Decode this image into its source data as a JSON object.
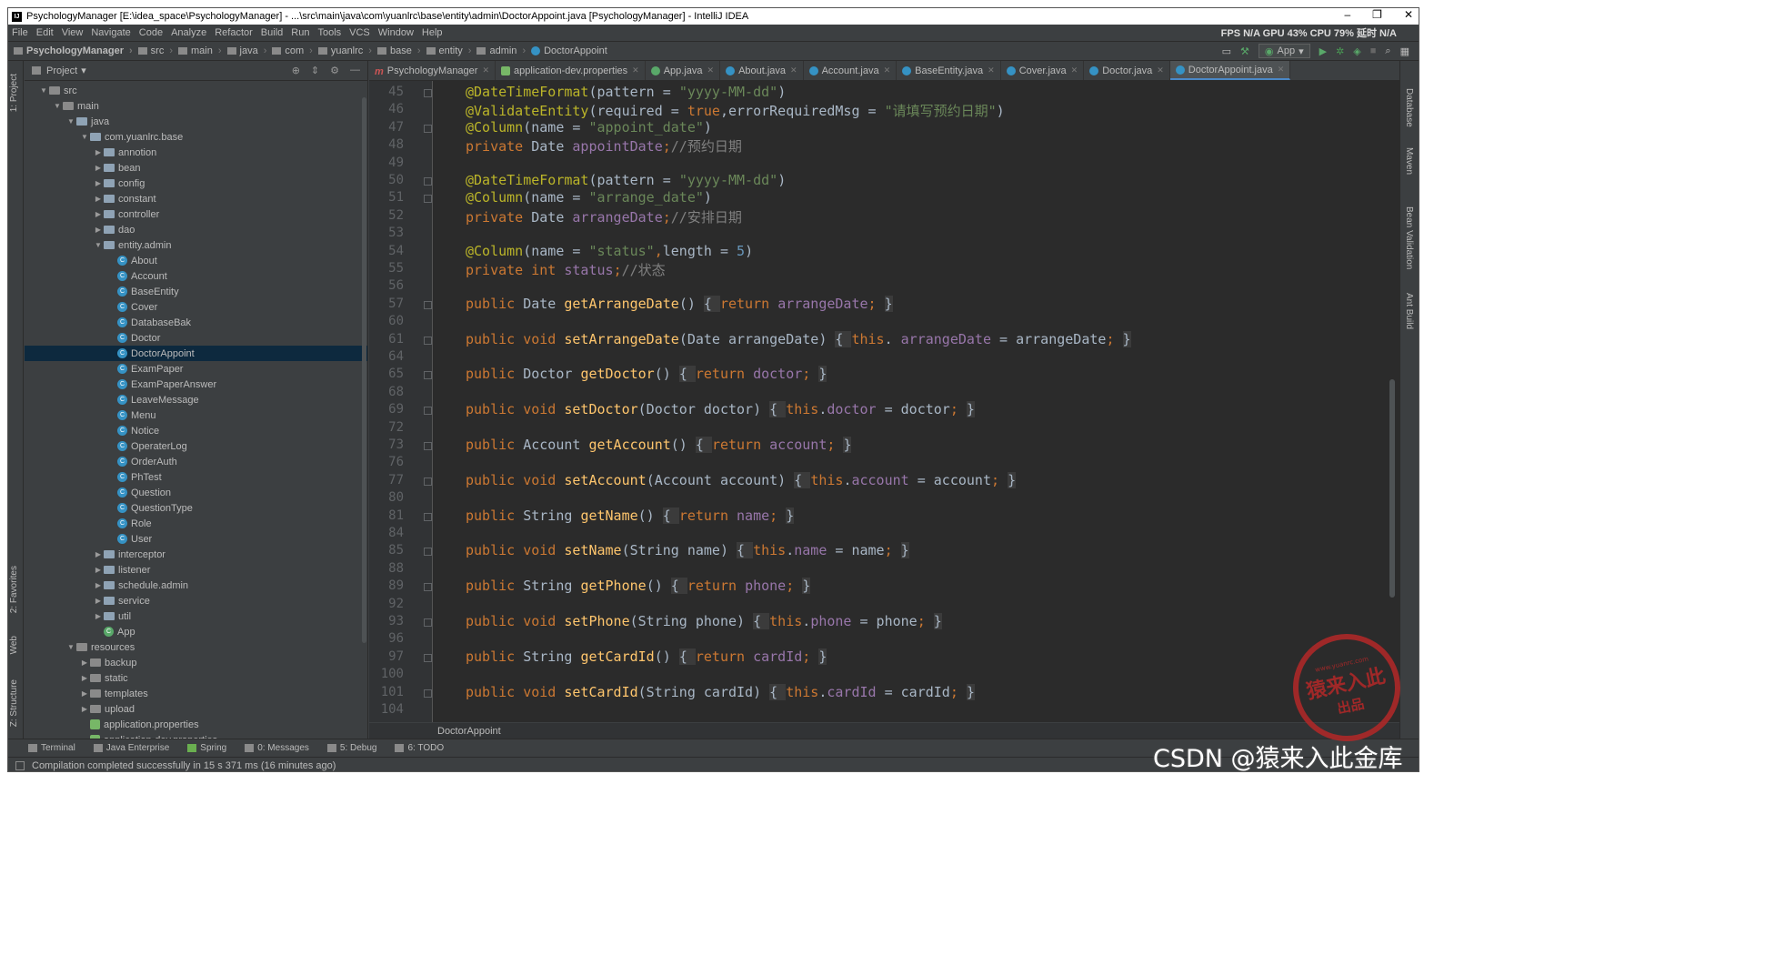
{
  "window": {
    "title": "PsychologyManager [E:\\idea_space\\PsychologyManager] - ...\\src\\main\\java\\com\\yuanlrc\\base\\entity\\admin\\DoctorAppoint.java [PsychologyManager] - IntelliJ IDEA",
    "controls": [
      "–",
      "❐",
      "✕"
    ]
  },
  "menu": {
    "items": [
      "File",
      "Edit",
      "View",
      "Navigate",
      "Code",
      "Analyze",
      "Refactor",
      "Build",
      "Run",
      "Tools",
      "VCS",
      "Window",
      "Help"
    ],
    "perf": "FPS N/A GPU 43% CPU 79% 延时 N/A"
  },
  "nav": {
    "crumbs": [
      "PsychologyManager",
      "src",
      "main",
      "java",
      "com",
      "yuanlrc",
      "base",
      "entity",
      "admin",
      "DoctorAppoint"
    ],
    "run_config": "App"
  },
  "left_tabs": [
    "1: Project",
    "2: Favorites",
    "Web",
    "Z: Structure"
  ],
  "right_tabs": [
    "Database",
    "Maven",
    "Bean Validation",
    "Ant Build"
  ],
  "project": {
    "header": "Project",
    "tree": [
      {
        "label": "src",
        "depth": 1,
        "arrow": "▼",
        "icon": "folder"
      },
      {
        "label": "main",
        "depth": 2,
        "arrow": "▼",
        "icon": "folder"
      },
      {
        "label": "java",
        "depth": 3,
        "arrow": "▼",
        "icon": "folder-blue"
      },
      {
        "label": "com.yuanlrc.base",
        "depth": 4,
        "arrow": "▼",
        "icon": "package"
      },
      {
        "label": "annotion",
        "depth": 5,
        "arrow": "▶",
        "icon": "package"
      },
      {
        "label": "bean",
        "depth": 5,
        "arrow": "▶",
        "icon": "package"
      },
      {
        "label": "config",
        "depth": 5,
        "arrow": "▶",
        "icon": "package"
      },
      {
        "label": "constant",
        "depth": 5,
        "arrow": "▶",
        "icon": "package"
      },
      {
        "label": "controller",
        "depth": 5,
        "arrow": "▶",
        "icon": "package"
      },
      {
        "label": "dao",
        "depth": 5,
        "arrow": "▶",
        "icon": "package"
      },
      {
        "label": "entity.admin",
        "depth": 5,
        "arrow": "▼",
        "icon": "package"
      },
      {
        "label": "About",
        "depth": 6,
        "arrow": "",
        "icon": "class"
      },
      {
        "label": "Account",
        "depth": 6,
        "arrow": "",
        "icon": "class"
      },
      {
        "label": "BaseEntity",
        "depth": 6,
        "arrow": "",
        "icon": "class"
      },
      {
        "label": "Cover",
        "depth": 6,
        "arrow": "",
        "icon": "class"
      },
      {
        "label": "DatabaseBak",
        "depth": 6,
        "arrow": "",
        "icon": "class"
      },
      {
        "label": "Doctor",
        "depth": 6,
        "arrow": "",
        "icon": "class"
      },
      {
        "label": "DoctorAppoint",
        "depth": 6,
        "arrow": "",
        "icon": "class",
        "selected": true
      },
      {
        "label": "ExamPaper",
        "depth": 6,
        "arrow": "",
        "icon": "class"
      },
      {
        "label": "ExamPaperAnswer",
        "depth": 6,
        "arrow": "",
        "icon": "class"
      },
      {
        "label": "LeaveMessage",
        "depth": 6,
        "arrow": "",
        "icon": "class"
      },
      {
        "label": "Menu",
        "depth": 6,
        "arrow": "",
        "icon": "class"
      },
      {
        "label": "Notice",
        "depth": 6,
        "arrow": "",
        "icon": "class"
      },
      {
        "label": "OperaterLog",
        "depth": 6,
        "arrow": "",
        "icon": "class"
      },
      {
        "label": "OrderAuth",
        "depth": 6,
        "arrow": "",
        "icon": "class"
      },
      {
        "label": "PhTest",
        "depth": 6,
        "arrow": "",
        "icon": "class"
      },
      {
        "label": "Question",
        "depth": 6,
        "arrow": "",
        "icon": "class"
      },
      {
        "label": "QuestionType",
        "depth": 6,
        "arrow": "",
        "icon": "class"
      },
      {
        "label": "Role",
        "depth": 6,
        "arrow": "",
        "icon": "class"
      },
      {
        "label": "User",
        "depth": 6,
        "arrow": "",
        "icon": "class"
      },
      {
        "label": "interceptor",
        "depth": 5,
        "arrow": "▶",
        "icon": "package"
      },
      {
        "label": "listener",
        "depth": 5,
        "arrow": "▶",
        "icon": "package"
      },
      {
        "label": "schedule.admin",
        "depth": 5,
        "arrow": "▶",
        "icon": "package"
      },
      {
        "label": "service",
        "depth": 5,
        "arrow": "▶",
        "icon": "package"
      },
      {
        "label": "util",
        "depth": 5,
        "arrow": "▶",
        "icon": "package"
      },
      {
        "label": "App",
        "depth": 5,
        "arrow": "",
        "icon": "class-app"
      },
      {
        "label": "resources",
        "depth": 3,
        "arrow": "▼",
        "icon": "folder"
      },
      {
        "label": "backup",
        "depth": 4,
        "arrow": "▶",
        "icon": "folder"
      },
      {
        "label": "static",
        "depth": 4,
        "arrow": "▶",
        "icon": "folder"
      },
      {
        "label": "templates",
        "depth": 4,
        "arrow": "▶",
        "icon": "folder"
      },
      {
        "label": "upload",
        "depth": 4,
        "arrow": "▶",
        "icon": "folder"
      },
      {
        "label": "application.properties",
        "depth": 4,
        "arrow": "",
        "icon": "properties"
      },
      {
        "label": "application-dev.properties",
        "depth": 4,
        "arrow": "",
        "icon": "properties"
      }
    ]
  },
  "tabs": [
    {
      "label": "PsychologyManager",
      "icon": "m"
    },
    {
      "label": "application-dev.properties",
      "icon": "p"
    },
    {
      "label": "App.java",
      "icon": "a"
    },
    {
      "label": "About.java",
      "icon": "c"
    },
    {
      "label": "Account.java",
      "icon": "c"
    },
    {
      "label": "BaseEntity.java",
      "icon": "c"
    },
    {
      "label": "Cover.java",
      "icon": "c"
    },
    {
      "label": "Doctor.java",
      "icon": "c"
    },
    {
      "label": "DoctorAppoint.java",
      "icon": "c",
      "active": true
    }
  ],
  "code": [
    {
      "n": "45",
      "fold": true,
      "tokens": [
        [
          "an",
          "@DateTimeFormat"
        ],
        [
          "",
          "(pattern = "
        ],
        [
          "st",
          "\"yyyy-MM-dd\""
        ],
        [
          "",
          ")"
        ]
      ]
    },
    {
      "n": "46",
      "fold": false,
      "tokens": [
        [
          "an",
          "@ValidateEntity"
        ],
        [
          "",
          "(required = "
        ],
        [
          "kw",
          "true"
        ],
        [
          "",
          ",errorRequiredMsg = "
        ],
        [
          "st",
          "\"请填写预约日期\""
        ],
        [
          "",
          ")"
        ]
      ]
    },
    {
      "n": "47",
      "fold": true,
      "tokens": [
        [
          "an",
          "@Column"
        ],
        [
          "",
          "(name = "
        ],
        [
          "st",
          "\"appoint_date\""
        ],
        [
          "",
          ")"
        ]
      ]
    },
    {
      "n": "48",
      "fold": false,
      "tokens": [
        [
          "kw",
          "private "
        ],
        [
          "",
          "Date "
        ],
        [
          "fd",
          "appointDate"
        ],
        [
          "kw",
          ";"
        ],
        [
          "cm",
          "//预约日期"
        ]
      ]
    },
    {
      "n": "49",
      "fold": false,
      "tokens": []
    },
    {
      "n": "50",
      "fold": true,
      "tokens": [
        [
          "an",
          "@DateTimeFormat"
        ],
        [
          "",
          "(pattern = "
        ],
        [
          "st",
          "\"yyyy-MM-dd\""
        ],
        [
          "",
          ")"
        ]
      ]
    },
    {
      "n": "51",
      "fold": true,
      "tokens": [
        [
          "an",
          "@Column"
        ],
        [
          "",
          "(name = "
        ],
        [
          "st",
          "\"arrange_date\""
        ],
        [
          "",
          ")"
        ]
      ]
    },
    {
      "n": "52",
      "fold": false,
      "tokens": [
        [
          "kw",
          "private "
        ],
        [
          "",
          "Date "
        ],
        [
          "fd",
          "arrangeDate"
        ],
        [
          "kw",
          ";"
        ],
        [
          "cm",
          "//安排日期"
        ]
      ]
    },
    {
      "n": "53",
      "fold": false,
      "tokens": []
    },
    {
      "n": "54",
      "fold": false,
      "tokens": [
        [
          "an",
          "@Column"
        ],
        [
          "",
          "(name = "
        ],
        [
          "st",
          "\"status\""
        ],
        [
          "kw",
          ","
        ],
        [
          "",
          "length = "
        ],
        [
          "nu",
          "5"
        ],
        [
          "",
          ")"
        ]
      ]
    },
    {
      "n": "55",
      "fold": false,
      "tokens": [
        [
          "kw",
          "private int "
        ],
        [
          "fd",
          "status"
        ],
        [
          "kw",
          ";"
        ],
        [
          "cm",
          "//状态"
        ]
      ]
    },
    {
      "n": "56",
      "fold": false,
      "tokens": []
    },
    {
      "n": "57",
      "fold": true,
      "tokens": [
        [
          "kw",
          "public "
        ],
        [
          "",
          "Date "
        ],
        [
          "fn",
          "getArrangeDate"
        ],
        [
          "",
          "() "
        ],
        [
          "br",
          "{ "
        ],
        [
          "kw",
          "return "
        ],
        [
          "fd",
          "arrangeDate"
        ],
        [
          "kw",
          "; "
        ],
        [
          "br",
          "}"
        ]
      ]
    },
    {
      "n": "60",
      "fold": false,
      "tokens": []
    },
    {
      "n": "61",
      "fold": true,
      "tokens": [
        [
          "kw",
          "public void "
        ],
        [
          "fn",
          "setArrangeDate"
        ],
        [
          "",
          "(Date arrangeDate) "
        ],
        [
          "br",
          "{ "
        ],
        [
          "kw",
          "this"
        ],
        [
          "",
          ". "
        ],
        [
          "fd",
          "arrangeDate"
        ],
        [
          "",
          " = arrangeDate"
        ],
        [
          "kw",
          "; "
        ],
        [
          "br",
          "}"
        ]
      ]
    },
    {
      "n": "64",
      "fold": false,
      "tokens": []
    },
    {
      "n": "65",
      "fold": true,
      "tokens": [
        [
          "kw",
          "public "
        ],
        [
          "",
          "Doctor "
        ],
        [
          "fn",
          "getDoctor"
        ],
        [
          "",
          "() "
        ],
        [
          "br",
          "{ "
        ],
        [
          "kw",
          "return "
        ],
        [
          "fd",
          "doctor"
        ],
        [
          "kw",
          "; "
        ],
        [
          "br",
          "}"
        ]
      ]
    },
    {
      "n": "68",
      "fold": false,
      "tokens": []
    },
    {
      "n": "69",
      "fold": true,
      "tokens": [
        [
          "kw",
          "public void "
        ],
        [
          "fn",
          "setDoctor"
        ],
        [
          "",
          "(Doctor doctor) "
        ],
        [
          "br",
          "{ "
        ],
        [
          "kw",
          "this"
        ],
        [
          "",
          "."
        ],
        [
          "fd",
          "doctor"
        ],
        [
          "",
          " = doctor"
        ],
        [
          "kw",
          "; "
        ],
        [
          "br",
          "}"
        ]
      ]
    },
    {
      "n": "72",
      "fold": false,
      "tokens": []
    },
    {
      "n": "73",
      "fold": true,
      "tokens": [
        [
          "kw",
          "public "
        ],
        [
          "",
          "Account "
        ],
        [
          "fn",
          "getAccount"
        ],
        [
          "",
          "() "
        ],
        [
          "br",
          "{ "
        ],
        [
          "kw",
          "return "
        ],
        [
          "fd",
          "account"
        ],
        [
          "kw",
          "; "
        ],
        [
          "br",
          "}"
        ]
      ]
    },
    {
      "n": "76",
      "fold": false,
      "tokens": []
    },
    {
      "n": "77",
      "fold": true,
      "tokens": [
        [
          "kw",
          "public void "
        ],
        [
          "fn",
          "setAccount"
        ],
        [
          "",
          "(Account account) "
        ],
        [
          "br",
          "{ "
        ],
        [
          "kw",
          "this"
        ],
        [
          "",
          "."
        ],
        [
          "fd",
          "account"
        ],
        [
          "",
          " = account"
        ],
        [
          "kw",
          "; "
        ],
        [
          "br",
          "}"
        ]
      ]
    },
    {
      "n": "80",
      "fold": false,
      "tokens": []
    },
    {
      "n": "81",
      "fold": true,
      "tokens": [
        [
          "kw",
          "public "
        ],
        [
          "",
          "String "
        ],
        [
          "fn",
          "getName"
        ],
        [
          "",
          "() "
        ],
        [
          "br",
          "{ "
        ],
        [
          "kw",
          "return "
        ],
        [
          "fd",
          "name"
        ],
        [
          "kw",
          "; "
        ],
        [
          "br",
          "}"
        ]
      ]
    },
    {
      "n": "84",
      "fold": false,
      "tokens": []
    },
    {
      "n": "85",
      "fold": true,
      "tokens": [
        [
          "kw",
          "public void "
        ],
        [
          "fn",
          "setName"
        ],
        [
          "",
          "(String name) "
        ],
        [
          "br",
          "{ "
        ],
        [
          "kw",
          "this"
        ],
        [
          "",
          "."
        ],
        [
          "fd",
          "name"
        ],
        [
          "",
          " = name"
        ],
        [
          "kw",
          "; "
        ],
        [
          "br",
          "}"
        ]
      ]
    },
    {
      "n": "88",
      "fold": false,
      "tokens": []
    },
    {
      "n": "89",
      "fold": true,
      "tokens": [
        [
          "kw",
          "public "
        ],
        [
          "",
          "String "
        ],
        [
          "fn",
          "getPhone"
        ],
        [
          "",
          "() "
        ],
        [
          "br",
          "{ "
        ],
        [
          "kw",
          "return "
        ],
        [
          "fd",
          "phone"
        ],
        [
          "kw",
          "; "
        ],
        [
          "br",
          "}"
        ]
      ]
    },
    {
      "n": "92",
      "fold": false,
      "tokens": []
    },
    {
      "n": "93",
      "fold": true,
      "tokens": [
        [
          "kw",
          "public void "
        ],
        [
          "fn",
          "setPhone"
        ],
        [
          "",
          "(String phone) "
        ],
        [
          "br",
          "{ "
        ],
        [
          "kw",
          "this"
        ],
        [
          "",
          "."
        ],
        [
          "fd",
          "phone"
        ],
        [
          "",
          " = phone"
        ],
        [
          "kw",
          "; "
        ],
        [
          "br",
          "}"
        ]
      ]
    },
    {
      "n": "96",
      "fold": false,
      "tokens": []
    },
    {
      "n": "97",
      "fold": true,
      "tokens": [
        [
          "kw",
          "public "
        ],
        [
          "",
          "String "
        ],
        [
          "fn",
          "getCardId"
        ],
        [
          "",
          "() "
        ],
        [
          "br",
          "{ "
        ],
        [
          "kw",
          "return "
        ],
        [
          "fd",
          "cardId"
        ],
        [
          "kw",
          "; "
        ],
        [
          "br",
          "}"
        ]
      ]
    },
    {
      "n": "100",
      "fold": false,
      "tokens": []
    },
    {
      "n": "101",
      "fold": true,
      "tokens": [
        [
          "kw",
          "public void "
        ],
        [
          "fn",
          "setCardId"
        ],
        [
          "",
          "(String cardId) "
        ],
        [
          "br",
          "{ "
        ],
        [
          "kw",
          "this"
        ],
        [
          "",
          "."
        ],
        [
          "fd",
          "cardId"
        ],
        [
          "",
          " = cardId"
        ],
        [
          "kw",
          "; "
        ],
        [
          "br",
          "}"
        ]
      ]
    },
    {
      "n": "104",
      "fold": false,
      "tokens": []
    }
  ],
  "editor_breadcrumb": "DoctorAppoint",
  "bottom_tools": [
    "Terminal",
    "Java Enterprise",
    "Spring",
    "0: Messages",
    "5: Debug",
    "6: TODO"
  ],
  "status": "Compilation completed successfully in 15 s 371 ms (16 minutes ago)",
  "stamp": {
    "top": "www.yuanrc.com",
    "main": "猿来入此",
    "bottom": "出品"
  },
  "watermark": "CSDN @猿来入此金库",
  "colors": {
    "bg": "#2b2b2b",
    "panel": "#3c3f41",
    "keyword": "#cc7832",
    "annotation": "#bbb529",
    "string": "#6a8759",
    "field": "#9876aa",
    "method": "#ffc66d",
    "number": "#6897bb",
    "comment": "#808080",
    "selection": "#0d293e"
  }
}
